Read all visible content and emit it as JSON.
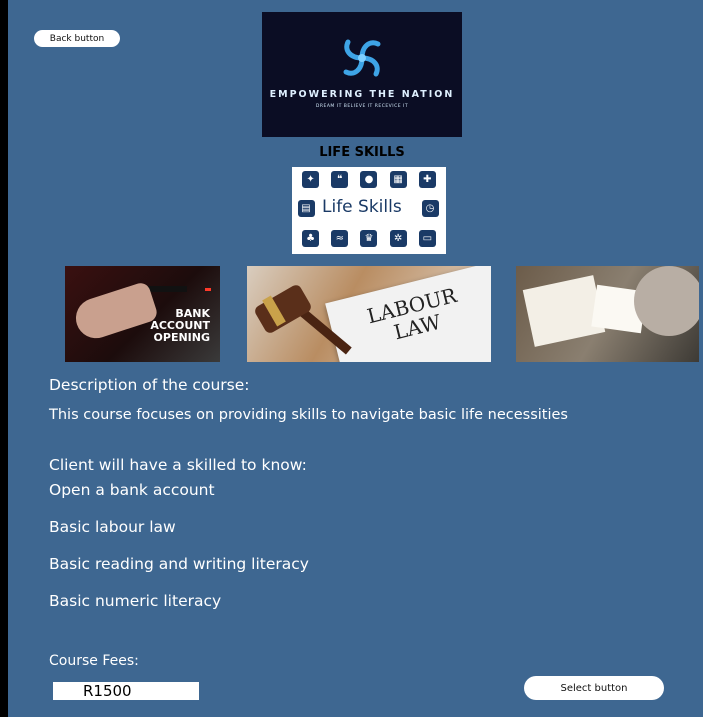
{
  "buttons": {
    "back": "Back button",
    "select": "Select button"
  },
  "logo": {
    "title": "EMPOWERING THE NATION",
    "tagline": "DREAM IT BELIEVE IT RECEVICE IT"
  },
  "course": {
    "title": "LIFE SKILLS",
    "graphic_text": "Life Skills",
    "photo_bank_text": [
      "BANK",
      "ACCOUNT",
      "OPENING"
    ],
    "photo_law_text": [
      "LABOUR",
      "LAW"
    ]
  },
  "description": {
    "heading": "Description of the course:",
    "body": "This course focuses on providing skills to navigate basic life necessities"
  },
  "client": {
    "heading": "Client will have a skilled to know:",
    "items": [
      "Open a bank account",
      "Basic labour law",
      "Basic reading and writing literacy",
      "Basic numeric literacy"
    ]
  },
  "fees": {
    "label": "Course Fees:",
    "value": "R1500"
  },
  "colors": {
    "background": "#3e6791",
    "logo_bg": "#0b0d24",
    "icon_blue": "#1a3a66"
  },
  "icons": [
    "lightbulb-icon",
    "chat-icon",
    "person-icon",
    "calculator-icon",
    "puzzle-icon",
    "document-icon",
    "clock-icon",
    "tree-icon",
    "handshake-icon",
    "trophy-icon",
    "gears-icon",
    "laptop-icon"
  ]
}
